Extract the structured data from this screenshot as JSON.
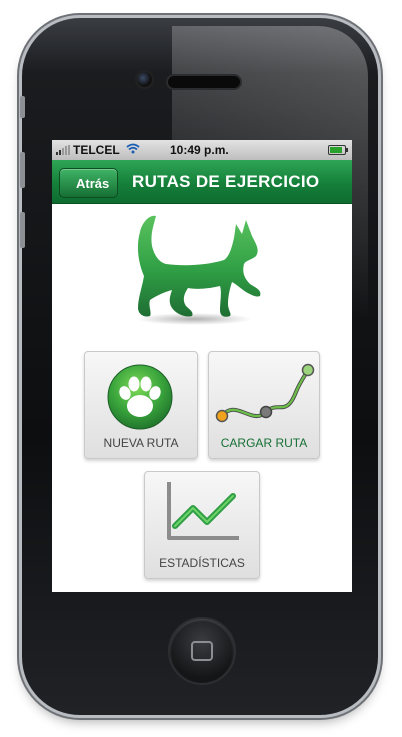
{
  "status_bar": {
    "carrier": "TELCEL",
    "time": "10:49 p.m.",
    "wifi_icon": "wifi-icon",
    "battery_level": 0.85
  },
  "nav_bar": {
    "back_label": "Atrás",
    "title": "RUTAS DE EJERCICIO",
    "color": "#15803a"
  },
  "tiles": {
    "nueva_ruta": {
      "label": "NUEVA RUTA",
      "icon": "paw-icon"
    },
    "cargar_ruta": {
      "label": "CARGAR RUTA",
      "icon": "route-icon"
    },
    "estadisticas": {
      "label": "ESTADÍSTICAS",
      "icon": "line-chart-icon"
    }
  },
  "logo": {
    "icon": "dog-silhouette-icon",
    "color": "#2f9e44"
  }
}
